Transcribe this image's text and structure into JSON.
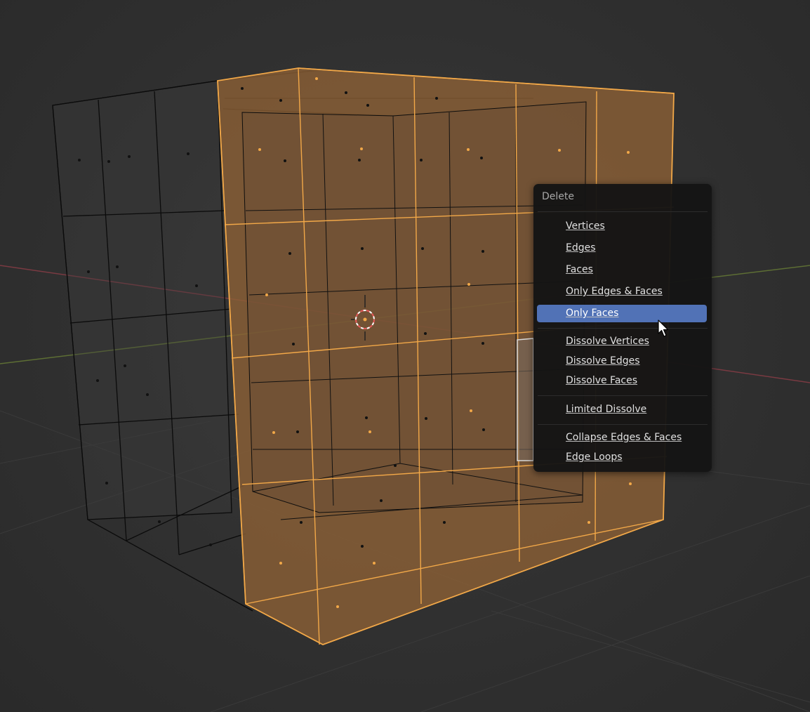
{
  "delete_menu": {
    "title": "Delete",
    "items": [
      {
        "label": "Vertices"
      },
      {
        "label": "Edges"
      },
      {
        "label": "Faces"
      },
      {
        "label": "Only Edges & Faces"
      },
      {
        "label": "Only Faces"
      },
      {
        "label": "Dissolve Vertices"
      },
      {
        "label": "Dissolve Edges"
      },
      {
        "label": "Dissolve Faces"
      },
      {
        "label": "Limited Dissolve"
      },
      {
        "label": "Collapse Edges & Faces"
      },
      {
        "label": "Edge Loops"
      }
    ],
    "highlighted_item": "Only Faces"
  },
  "viewport": {
    "mode": "edit-mode",
    "object": "subdivided-cube",
    "colors": {
      "background": "#303030",
      "selection": "#f0a845",
      "selected_face_fill": "#9b6b3a",
      "wire_unselected": "#0a0a0a",
      "x_axis": "#8a3f46",
      "y_axis": "#6a7d3a",
      "menu_highlight": "#5172b6"
    },
    "icons": [
      "3d-cursor-icon",
      "arrow-cursor-icon"
    ]
  }
}
